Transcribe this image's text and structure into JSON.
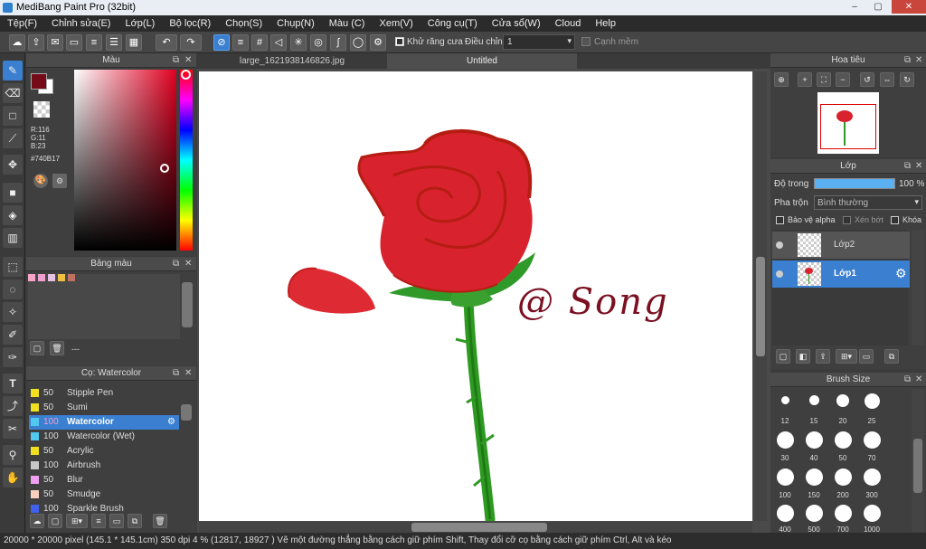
{
  "app": {
    "title": "MediBang Paint Pro (32bit)"
  },
  "menu": [
    "Tệp(F)",
    "Chỉnh sửa(E)",
    "Lớp(L)",
    "Bộ lọc(R)",
    "Chọn(S)",
    "Chụp(N)",
    "Màu (C)",
    "Xem(V)",
    "Công cụ(T)",
    "Cửa sổ(W)",
    "Cloud",
    "Help"
  ],
  "toolbar": {
    "antialias_label": "Khử răng cưa",
    "adjust_label": "Điều chỉnh",
    "adjust_value": "1",
    "smooth_label": "Cạnh mềm"
  },
  "color_panel": {
    "title": "Màu",
    "r": "R:116",
    "g": "G:11",
    "b": "B:23",
    "hex": "#740B17",
    "fg_color": "#740b17"
  },
  "palette_panel": {
    "title": "Bảng màu",
    "footer": "---",
    "swatches": [
      "#f6a3c8",
      "#f0a0d0",
      "#e6c0e0",
      "#f0c040",
      "#c07060"
    ]
  },
  "brush_panel": {
    "title": "Cọ: Watercolor",
    "brushes": [
      {
        "size": "50",
        "name": "Stipple Pen",
        "color": "#f0e020"
      },
      {
        "size": "50",
        "name": "Sumi",
        "color": "#f0e020"
      },
      {
        "size": "100",
        "name": "Watercolor",
        "color": "#50c8f0"
      },
      {
        "size": "100",
        "name": "Watercolor (Wet)",
        "color": "#50c8f0"
      },
      {
        "size": "50",
        "name": "Acrylic",
        "color": "#f0e020"
      },
      {
        "size": "100",
        "name": "Airbrush",
        "color": "#c8c8c8"
      },
      {
        "size": "50",
        "name": "Blur",
        "color": "#f0a0f0"
      },
      {
        "size": "50",
        "name": "Smudge",
        "color": "#f8d0c0"
      },
      {
        "size": "100",
        "name": "Sparkle Brush",
        "color": "#4060f0"
      }
    ]
  },
  "doc_tabs": [
    "large_1621938146826.jpg",
    "Untitled"
  ],
  "canvas": {
    "signature": "@ Song"
  },
  "navigator": {
    "title": "Hoa tiêu"
  },
  "layers": {
    "title": "Lớp",
    "opacity_label": "Độ trong",
    "opacity_value": "100 %",
    "blend_label": "Pha trộn",
    "blend_value": "Bình thường",
    "protect_alpha": "Bảo vệ alpha",
    "clipping": "Xén bớt",
    "lock": "Khóa",
    "items": [
      {
        "name": "Lớp2"
      },
      {
        "name": "Lớp1"
      }
    ]
  },
  "brush_size": {
    "title": "Brush Size",
    "sizes": [
      "12",
      "15",
      "20",
      "25",
      "30",
      "40",
      "50",
      "70",
      "100",
      "150",
      "200",
      "300",
      "400",
      "500",
      "700",
      "1000"
    ]
  },
  "status": {
    "text": "20000 * 20000 pixel   (145.1 * 145.1cm)   350 dpi   4 %   (12817, 18927 )   Vẽ một đường thẳng bằng cách giữ phím Shift, Thay đổi cỡ cọ bằng cách giữ phím Ctrl, Alt và kéo"
  }
}
